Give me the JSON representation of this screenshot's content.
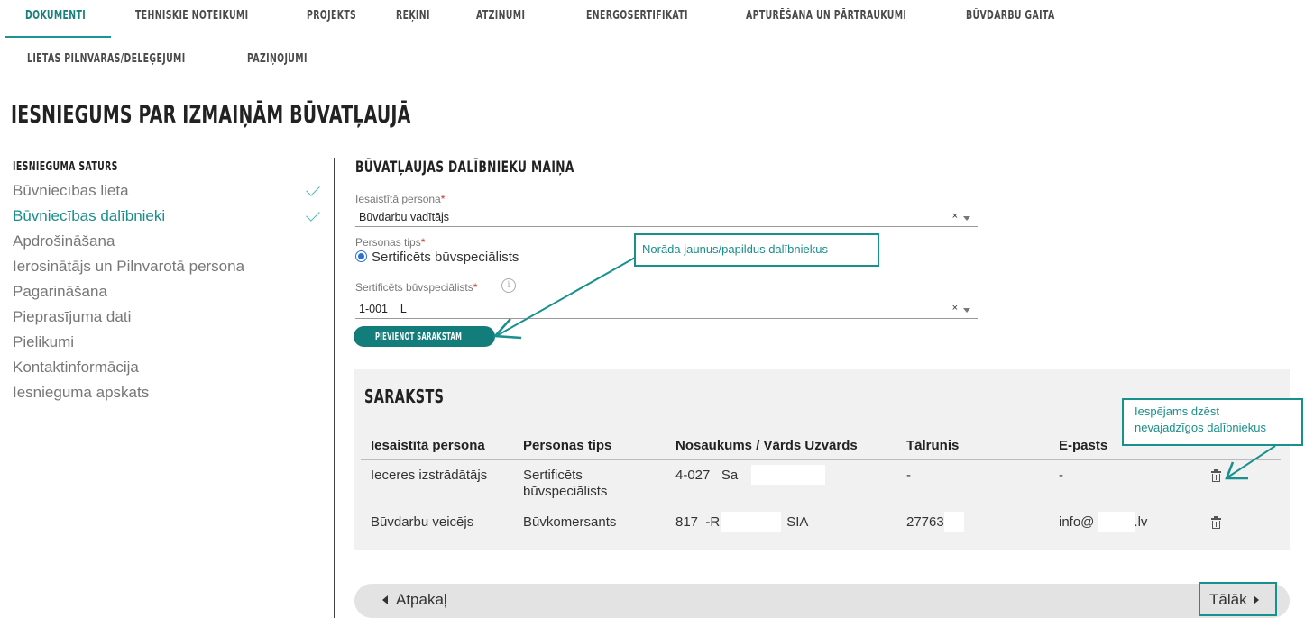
{
  "tabs": [
    {
      "label": "DOKUMENTI"
    },
    {
      "label": "TEHNISKIE NOTEIKUMI"
    },
    {
      "label": "PROJEKTS"
    },
    {
      "label": "RĒĶINI"
    },
    {
      "label": "ATZINUMI"
    },
    {
      "label": "ENERGOSERTIFIKĀTI"
    },
    {
      "label": "APTURĒŠANA UN PĀRTRAUKUMI"
    },
    {
      "label": "BŪVDARBU GAITA"
    },
    {
      "label": "LIETAS PILNVARAS/DELEĢĒJUMI"
    },
    {
      "label": "PAZIŅOJUMI"
    }
  ],
  "page_title": "IESNIEGUMS PAR IZMAIŅĀM BŪVATĻAUJĀ",
  "sidebar": {
    "heading": "IESNIEGUMA SATURS",
    "items": [
      {
        "label": "Būvniecības lieta",
        "completed": true
      },
      {
        "label": "Būvniecības dalībnieki",
        "completed": true
      },
      {
        "label": "Apdrošināšana"
      },
      {
        "label": "Ierosinātājs un Pilnvarotā persona"
      },
      {
        "label": "Pagarināšana"
      },
      {
        "label": "Pieprasījuma dati"
      },
      {
        "label": "Pielikumi"
      },
      {
        "label": "Kontaktinformācija"
      },
      {
        "label": "Iesnieguma apskats"
      }
    ]
  },
  "form": {
    "heading": "BŪVATĻAUJAS DALĪBNIEKU MAIŅA",
    "involved_person": {
      "label": "Iesaistītā persona",
      "required": "*",
      "value": "Būvdarbu vadītājs"
    },
    "person_type": {
      "label": "Personas tips",
      "required": "*",
      "option": "Sertificēts būvspeciālists"
    },
    "specialist": {
      "label": "Sertificēts būvspeciālists",
      "required": "*",
      "value": "1-001    L"
    },
    "clear_symbol": "×",
    "info_symbol": "i",
    "add_button": "PIEVIENOT SARAKSTAM"
  },
  "callouts": {
    "add_hint": "Norāda jaunus/papildus dalībniekus",
    "delete_hint_line1": "Iespējams dzēst",
    "delete_hint_line2": "nevajadzīgos dalībniekus"
  },
  "list": {
    "title": "SARAKSTS",
    "columns": [
      "Iesaistītā persona",
      "Personas tips",
      "Nosaukums / Vārds Uzvārds",
      "Tālrunis",
      "E-pasts"
    ],
    "rows": [
      {
        "person": "Ieceres izstrādātājs",
        "type_line1": "Sertificēts",
        "type_line2": "būvspeciālists",
        "name_a": "4-027",
        "name_b": "Sa",
        "name_c": "",
        "phone": "-",
        "email_a": "-",
        "email_b": ""
      },
      {
        "person": "Būvdarbu veicējs",
        "type_line1": "Būvkomersants",
        "type_line2": "",
        "name_a": "817",
        "name_b": "-R",
        "name_c": "SIA",
        "phone": "27763",
        "email_a": "info@",
        "email_b": ".lv"
      }
    ],
    "trash_icon": "trash-icon"
  },
  "nav": {
    "back": "Atpakaļ",
    "next": "Tālāk"
  },
  "colors": {
    "accent": "#1a8e8c",
    "button": "#127d7b",
    "panel": "#f1f1f1"
  }
}
